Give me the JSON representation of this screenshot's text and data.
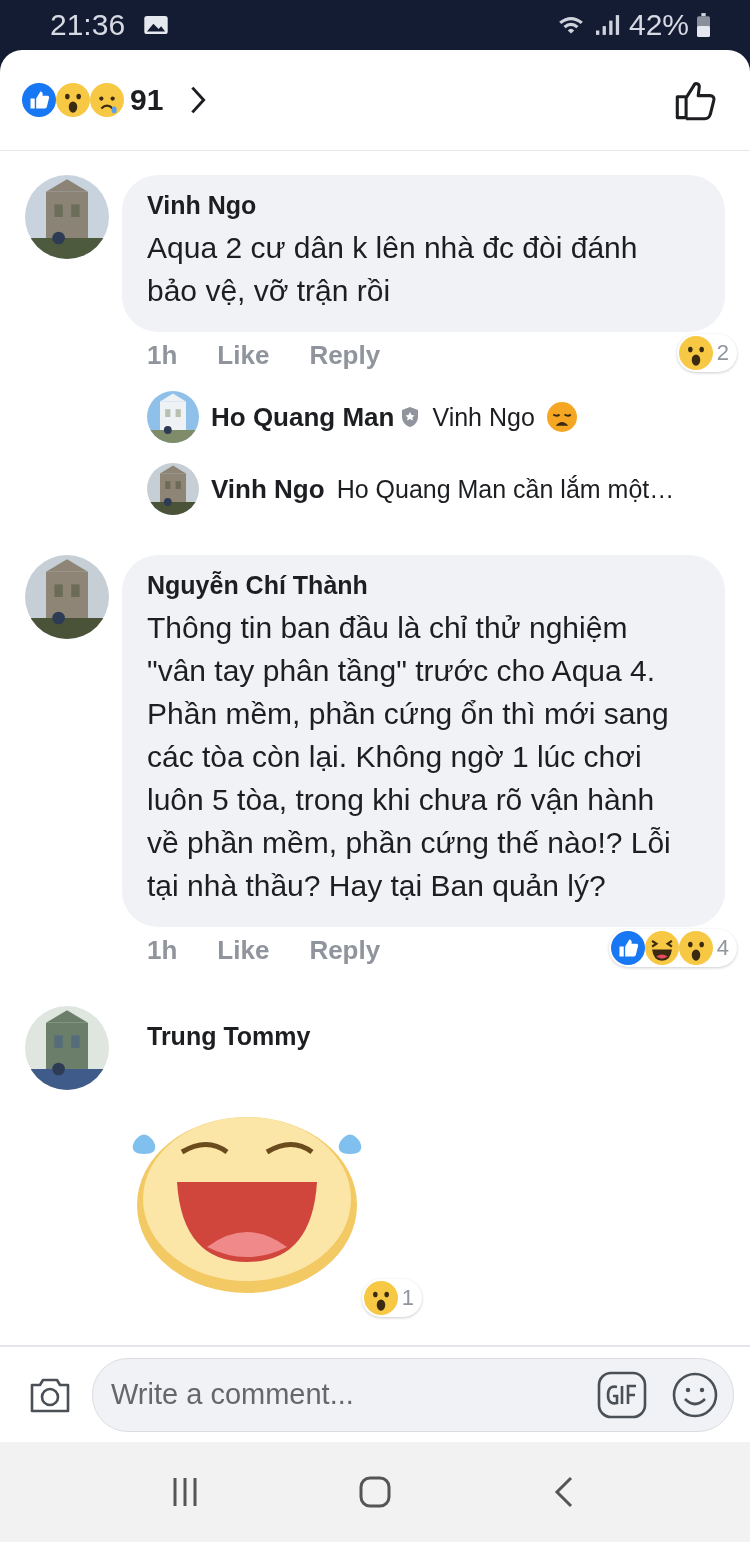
{
  "status_bar": {
    "time": "21:36",
    "battery": "42%"
  },
  "header": {
    "reactions": [
      {
        "kind": "like"
      },
      {
        "kind": "wow"
      },
      {
        "kind": "sad"
      }
    ],
    "count": "91"
  },
  "comments": [
    {
      "kind": "text",
      "name": "Vinh Ngo",
      "text": "Aqua 2 cư dân k lên nhà đc đòi đánh bảo vệ, vỡ trận rồi",
      "time": "1h",
      "actions": [
        "Like",
        "Reply"
      ],
      "reactions": [
        {
          "kind": "wow"
        }
      ],
      "reaction_count": "2",
      "replies": [
        {
          "name": "Ho Quang Man",
          "verified": true,
          "text": "Vinh Ngo",
          "emoji": {
            "kind": "weary"
          }
        },
        {
          "name": "Vinh Ngo",
          "verified": false,
          "text": "Ho Quang Man cần lắm một…"
        }
      ]
    },
    {
      "kind": "text",
      "name": "Nguyễn Chí Thành",
      "text": "Thông tin ban đầu là chỉ thử nghiệm \"vân tay phân tầng\" trước cho Aqua 4. Phần mềm, phần cứng ổn thì mới sang các tòa còn lại. Không ngờ 1 lúc chơi luôn 5 tòa, trong khi chưa rõ vận hành về phần mềm, phần cứng thế nào!? Lỗi tại nhà thầu? Hay tại Ban quản lý?",
      "time": "1h",
      "actions": [
        "Like",
        "Reply"
      ],
      "reactions": [
        {
          "kind": "like"
        },
        {
          "kind": "haha"
        },
        {
          "kind": "wow"
        }
      ],
      "reaction_count": "4"
    },
    {
      "kind": "sticker",
      "name": "Trung Tommy",
      "reactions": [
        {
          "kind": "wow"
        }
      ],
      "reaction_count": "1"
    }
  ],
  "composer": {
    "placeholder": "Write a comment..."
  }
}
